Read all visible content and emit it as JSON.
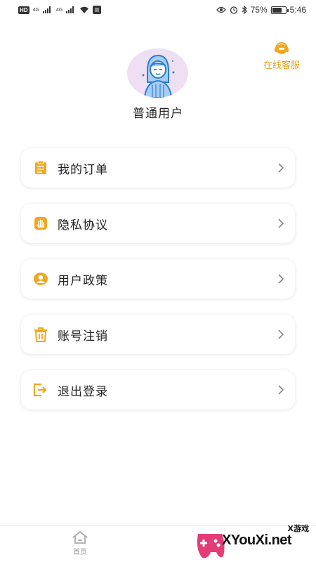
{
  "status_bar": {
    "hd": "HD",
    "net1": "4G",
    "net2": "4G",
    "battery": "75%",
    "battery_level": 0.75,
    "time": "5:46"
  },
  "profile": {
    "username": "普通用户",
    "avatar_icon": "user-avatar-icon"
  },
  "service": {
    "label": "在线客服",
    "icon": "headset-icon"
  },
  "menu": [
    {
      "label": "我的订单",
      "icon": "clipboard-icon"
    },
    {
      "label": "隐私协议",
      "icon": "hand-icon"
    },
    {
      "label": "用户政策",
      "icon": "user-circle-icon"
    },
    {
      "label": "账号注销",
      "icon": "trash-icon"
    },
    {
      "label": "退出登录",
      "icon": "logout-icon"
    }
  ],
  "bottom_nav": {
    "home_label": "首页"
  },
  "watermark": {
    "text": "XYouXi.net",
    "tag": "X游戏"
  },
  "colors": {
    "accent": "#f0a823",
    "chevron": "#888888",
    "avatar_bg": "#efdff2",
    "avatar_line": "#2a7fd4"
  }
}
